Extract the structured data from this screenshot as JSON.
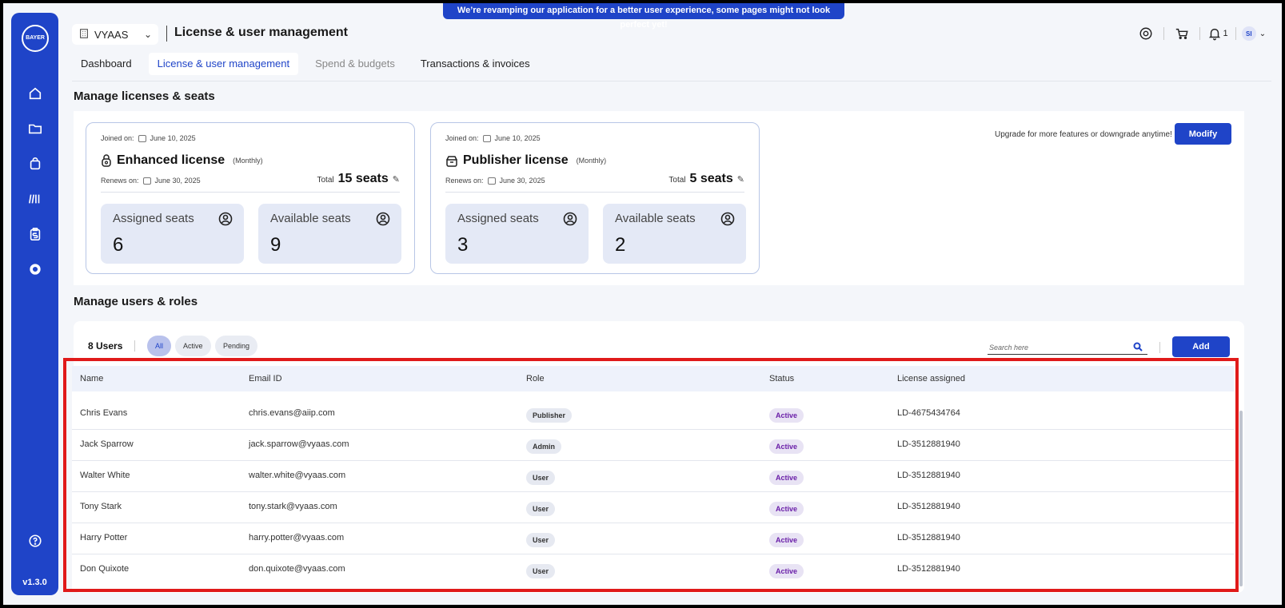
{
  "banner": "We’re revamping our application for a better user experience, some pages might not look perfect yet!",
  "sidebar": {
    "logo_text": "BAYER",
    "version": "v1.3.0"
  },
  "header": {
    "org": "VYAAS",
    "title": "License & user management",
    "notifications_count": "1",
    "avatar_initials": "SI"
  },
  "tabs": [
    {
      "label": "Dashboard"
    },
    {
      "label": "License & user management"
    },
    {
      "label": "Spend & budgets"
    },
    {
      "label": "Transactions & invoices"
    }
  ],
  "licenses": {
    "section_title": "Manage licenses & seats",
    "upgrade_text": "Upgrade for more features or downgrade anytime!",
    "modify_label": "Modify",
    "cards": [
      {
        "joined_label": "Joined on:",
        "joined_date": "June 10, 2025",
        "name": "Enhanced license",
        "period": "(Monthly)",
        "renews_label": "Renews on:",
        "renews_date": "June 30, 2025",
        "total_label": "Total",
        "total_seats": "15 seats",
        "assigned_label": "Assigned seats",
        "assigned": "6",
        "available_label": "Available seats",
        "available": "9"
      },
      {
        "joined_label": "Joined on:",
        "joined_date": "June 10, 2025",
        "name": "Publisher license",
        "period": "(Monthly)",
        "renews_label": "Renews on:",
        "renews_date": "June 30, 2025",
        "total_label": "Total",
        "total_seats": "5 seats",
        "assigned_label": "Assigned seats",
        "assigned": "3",
        "available_label": "Available seats",
        "available": "2"
      }
    ]
  },
  "users": {
    "section_title": "Manage users & roles",
    "count": "8 Users",
    "filters": [
      "All",
      "Active",
      "Pending"
    ],
    "search_placeholder": "Search here",
    "add_label": "Add",
    "columns": [
      "Name",
      "Email ID",
      "Role",
      "Status",
      "License assigned"
    ],
    "rows": [
      {
        "name": "Chris Evans",
        "email": "chris.evans@aiip.com",
        "role": "Publisher",
        "status": "Active",
        "license": "LD-4675434764"
      },
      {
        "name": "Jack Sparrow",
        "email": "jack.sparrow@vyaas.com",
        "role": "Admin",
        "status": "Active",
        "license": "LD-3512881940"
      },
      {
        "name": "Walter White",
        "email": "walter.white@vyaas.com",
        "role": "User",
        "status": "Active",
        "license": "LD-3512881940"
      },
      {
        "name": "Tony Stark",
        "email": "tony.stark@vyaas.com",
        "role": "User",
        "status": "Active",
        "license": "LD-3512881940"
      },
      {
        "name": "Harry Potter",
        "email": "harry.potter@vyaas.com",
        "role": "User",
        "status": "Active",
        "license": "LD-3512881940"
      },
      {
        "name": "Don Quixote",
        "email": "don.quixote@vyaas.com",
        "role": "User",
        "status": "Active",
        "license": "LD-3512881940"
      }
    ]
  },
  "colors": {
    "brand": "#1f44c8",
    "highlight_border": "#e01a1a",
    "status_active_text": "#6a1fa8"
  }
}
